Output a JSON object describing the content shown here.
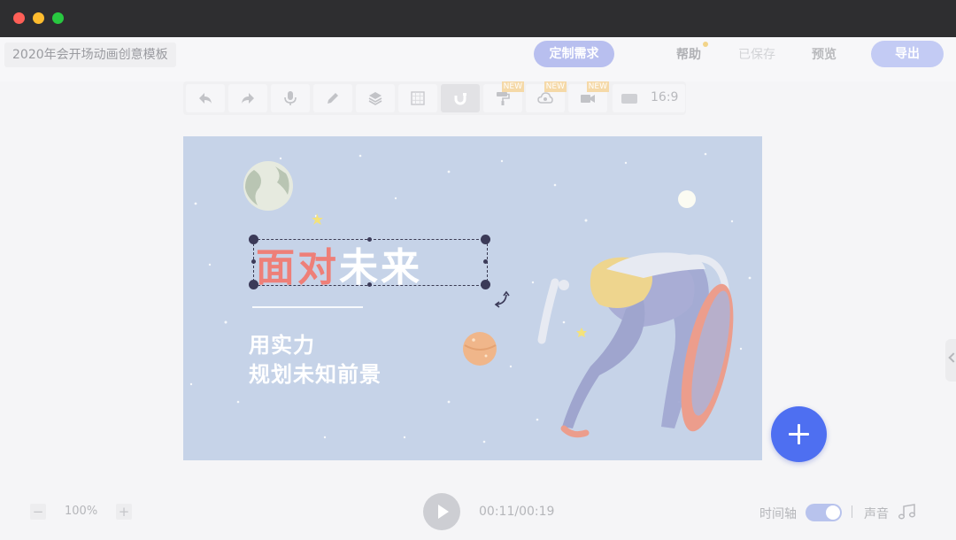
{
  "window": {
    "controls": [
      "close",
      "minimize",
      "zoom"
    ]
  },
  "header": {
    "doc_title": "2020年会开场动画创意模板",
    "custom_button": "定制需求",
    "help": "帮助",
    "saved": "已保存",
    "preview": "预览",
    "export": "导出"
  },
  "toolbar": {
    "tools": [
      {
        "icon": "undo-icon"
      },
      {
        "icon": "redo-icon"
      },
      {
        "icon": "microphone-icon"
      },
      {
        "icon": "pencil-icon"
      },
      {
        "icon": "layers-icon"
      },
      {
        "icon": "grid-icon"
      },
      {
        "icon": "magnet-icon",
        "active": true
      },
      {
        "icon": "paint-roller-icon",
        "badge": "NEW"
      },
      {
        "icon": "cloud-icon",
        "badge": "NEW"
      },
      {
        "icon": "video-camera-icon",
        "badge": "NEW"
      }
    ],
    "aspect_ratio": "16:9"
  },
  "canvas": {
    "headline_part1": "面对",
    "headline_part2": "未来",
    "subline1": "用实力",
    "subline2": "规划未知前景"
  },
  "footer": {
    "zoom_out": "−",
    "zoom_level": "100%",
    "zoom_in": "+",
    "time": "00:11/00:19",
    "timeline_label": "时间轴",
    "timeline_enabled": true,
    "sound_label": "声音"
  },
  "colors": {
    "accent": "#4e6ff1",
    "canvas_bg": "#c6d3e8",
    "headline_red": "#ee7f78"
  }
}
